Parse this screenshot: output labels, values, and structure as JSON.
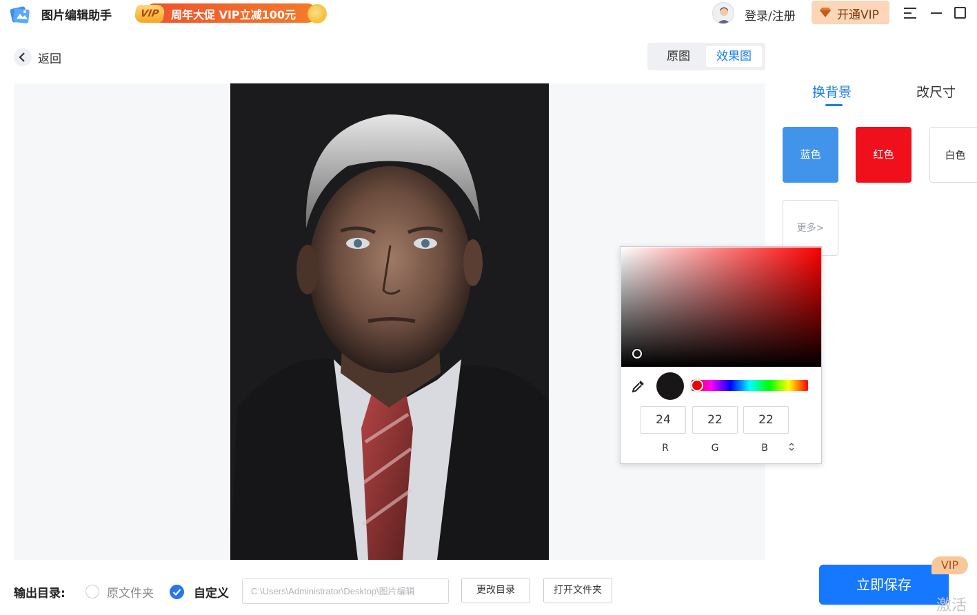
{
  "app": {
    "name": "图片编辑助手"
  },
  "promo": {
    "badge": "VIP",
    "text": "周年大促 VIP立减100元"
  },
  "header": {
    "login": "登录/注册",
    "vip_button": "开通VIP"
  },
  "nav": {
    "back": "返回"
  },
  "view_tabs": {
    "original": "原图",
    "effect": "效果图",
    "active": "effect"
  },
  "side_panel": {
    "tabs": [
      {
        "label": "换背景",
        "active": true
      },
      {
        "label": "改尺寸",
        "active": false
      }
    ],
    "swatches": [
      {
        "label": "蓝色",
        "color": "#4194ea"
      },
      {
        "label": "红色",
        "color": "#ef101c"
      },
      {
        "label": "白色",
        "color": "#ffffff"
      }
    ],
    "more": "更多>"
  },
  "color_picker": {
    "r": "24",
    "g": "22",
    "b": "22",
    "r_label": "R",
    "g_label": "G",
    "b_label": "B",
    "hue_color": "#ff0000"
  },
  "bottom": {
    "output_label": "输出目录:",
    "option_original": "原文件夹",
    "option_custom": "自定义",
    "selected": "custom",
    "path": "C:\\Users\\Administrator\\Desktop\\图片编辑",
    "change_dir": "更改目录",
    "open_folder": "打开文件夹",
    "save": "立即保存",
    "save_badge": "VIP"
  },
  "system": {
    "activate_text": "激活"
  },
  "colors": {
    "accent": "#1677ff",
    "link": "#1c7ee8"
  }
}
